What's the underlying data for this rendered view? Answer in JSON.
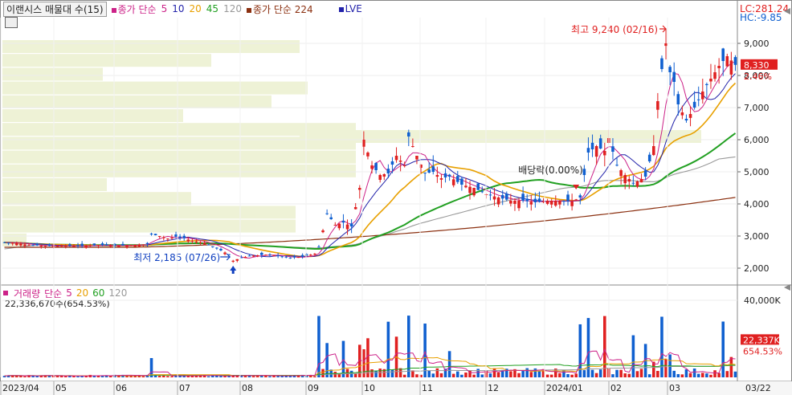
{
  "header": {
    "symbol": "이랜시스 매물대 수(15)",
    "ma_price_label": "종가 단순",
    "ma_periods": [
      "5",
      "10",
      "20",
      "45",
      "120"
    ],
    "ma_long_label": "종가 단순 224",
    "lve_label": "LVE",
    "lc_label": "LC:281.24",
    "hc_label": "HC:-9.85"
  },
  "colors": {
    "up": "#e02020",
    "down": "#1060d0",
    "ma5": "#cc2288",
    "ma10": "#2222aa",
    "ma20": "#e8a000",
    "ma45": "#22a022",
    "ma120": "#999999",
    "ma224": "#8b3010",
    "volume_profile": "#eef2d6",
    "current_price_bg": "#e02020"
  },
  "price_axis_ticks": [
    "9,000",
    "8,000",
    "7,000",
    "6,000",
    "5,000",
    "4,000",
    "3,000",
    "2,000"
  ],
  "current_price": {
    "value": "8,330",
    "change": "2.46%"
  },
  "annotations": {
    "high": "최고 9,240 (02/16)",
    "low": "최저 2,185 (07/26)",
    "dividend": "배당락(0.00%)"
  },
  "volume": {
    "label": "거래량",
    "ma_label": "단순",
    "ma_periods": [
      "5",
      "20",
      "60",
      "120"
    ],
    "value_text": "22,336,670주(654.53%)",
    "axis_tick": "40,000K",
    "current_value": "22,337K",
    "current_pct": "654.53%"
  },
  "x_axis_ticks": [
    "2023/04",
    "05",
    "06",
    "07",
    "08",
    "09",
    "10",
    "11",
    "12",
    "2024/01",
    "02",
    "03",
    "03/22"
  ],
  "chart_data": {
    "type": "candlestick",
    "title": "이랜시스",
    "price_range": [
      1500,
      9800
    ],
    "volume_range_k": [
      0,
      46000
    ],
    "highlights": {
      "high": {
        "date": "02/16",
        "value": 9240
      },
      "low": {
        "date": "07/26",
        "value": 2185
      },
      "last": {
        "date": "03/22",
        "value": 8330,
        "change_pct": 2.46
      }
    },
    "months": [
      "2023/04",
      "05",
      "06",
      "07",
      "08",
      "09",
      "10",
      "11",
      "12",
      "2024/01",
      "02",
      "03"
    ],
    "close_path": [
      [
        0,
        2800
      ],
      [
        3,
        2780
      ],
      [
        6,
        2720
      ],
      [
        9,
        2700
      ],
      [
        12,
        2690
      ],
      [
        15,
        2700
      ],
      [
        18,
        2690
      ],
      [
        21,
        2710
      ],
      [
        24,
        2720
      ],
      [
        27,
        2700
      ],
      [
        30,
        2710
      ],
      [
        33,
        2730
      ],
      [
        35,
        2750
      ],
      [
        36,
        3050
      ],
      [
        38,
        3000
      ],
      [
        40,
        2920
      ],
      [
        42,
        2980
      ],
      [
        44,
        2930
      ],
      [
        46,
        2850
      ],
      [
        49,
        2790
      ],
      [
        52,
        2620
      ],
      [
        55,
        2420
      ],
      [
        56,
        2230
      ],
      [
        58,
        2330
      ],
      [
        61,
        2390
      ],
      [
        64,
        2420
      ],
      [
        67,
        2380
      ],
      [
        70,
        2320
      ],
      [
        73,
        2360
      ],
      [
        76,
        2450
      ],
      [
        77,
        2650
      ],
      [
        79,
        3700
      ],
      [
        81,
        3350
      ],
      [
        83,
        3420
      ],
      [
        85,
        3300
      ],
      [
        87,
        4500
      ],
      [
        88,
        6000
      ],
      [
        90,
        5200
      ],
      [
        92,
        4900
      ],
      [
        94,
        4950
      ],
      [
        96,
        5500
      ],
      [
        98,
        5200
      ],
      [
        99,
        6100
      ],
      [
        101,
        5500
      ],
      [
        103,
        4950
      ],
      [
        105,
        5000
      ],
      [
        107,
        4800
      ],
      [
        109,
        4850
      ],
      [
        112,
        4600
      ],
      [
        115,
        4500
      ],
      [
        118,
        4300
      ],
      [
        121,
        4200
      ],
      [
        124,
        4100
      ],
      [
        127,
        4100
      ],
      [
        130,
        4050
      ],
      [
        133,
        4100
      ],
      [
        136,
        4100
      ],
      [
        139,
        4080
      ],
      [
        141,
        4200
      ],
      [
        143,
        5600
      ],
      [
        145,
        5800
      ],
      [
        147,
        5650
      ],
      [
        148,
        6050
      ],
      [
        150,
        5200
      ],
      [
        152,
        4900
      ],
      [
        154,
        4650
      ],
      [
        155,
        4700
      ],
      [
        157,
        4850
      ],
      [
        159,
        5800
      ],
      [
        160,
        7200
      ],
      [
        161,
        8200
      ],
      [
        162,
        9000
      ],
      [
        163,
        8100
      ],
      [
        164,
        7800
      ],
      [
        165,
        7100
      ],
      [
        167,
        6600
      ],
      [
        169,
        7000
      ],
      [
        171,
        7500
      ],
      [
        173,
        7900
      ],
      [
        175,
        8300
      ],
      [
        177,
        8600
      ],
      [
        179,
        8330
      ]
    ],
    "highlight_volume_days": [
      36,
      77,
      79,
      83,
      87,
      88,
      89,
      94,
      96,
      99,
      103,
      109,
      141,
      143,
      147,
      154,
      157,
      159,
      161,
      162,
      163,
      176,
      178
    ]
  }
}
